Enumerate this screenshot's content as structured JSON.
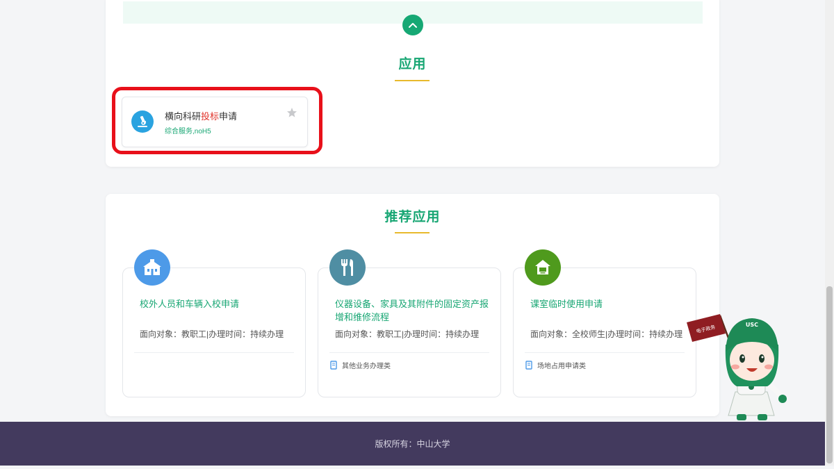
{
  "apps_section": {
    "title": "应用",
    "item": {
      "name_before": "横向科研",
      "name_highlight": "投标",
      "name_after": "申请",
      "tag": "综合服务,noH5",
      "icon": "microscope-icon"
    }
  },
  "recommended": {
    "title": "推荐应用",
    "items": [
      {
        "title": "校外人员和车辆入校申请",
        "meta": "面向对象：教职工|办理时间：持续办理",
        "category": "",
        "icon": "school-building-icon",
        "icon_color": "#4d9ae8"
      },
      {
        "title": "仪器设备、家具及其附件的固定资产报增和维修流程",
        "meta": "面向对象：教职工|办理时间：持续办理",
        "category": "其他业务办理类",
        "icon": "tools-icon",
        "icon_color": "#4f8ea3"
      },
      {
        "title": "课室临时使用申请",
        "meta": "面向对象：全校师生|办理时间：持续办理",
        "category": "场地占用申请类",
        "icon": "house-icon",
        "icon_color": "#4f9a1d"
      }
    ]
  },
  "footer": {
    "copyright": "版权所有：中山大学"
  },
  "mascot": {
    "flag_text": "电子政务",
    "helmet_text": "USC"
  },
  "colors": {
    "accent": "#17a673",
    "underline": "#e8b92c",
    "highlight_border": "#e8101a",
    "footer_bg": "#433a5e"
  }
}
